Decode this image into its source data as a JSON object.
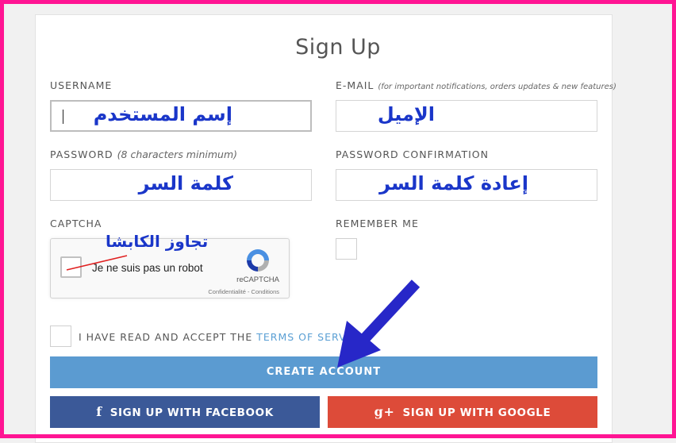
{
  "form": {
    "title": "Sign Up",
    "username_label": "USERNAME",
    "email_label": "E-MAIL",
    "email_note": "(for important notifications, orders updates & new features)",
    "password_label": "PASSWORD",
    "password_note": "(8 characters minimum)",
    "password_confirm_label": "PASSWORD CONFIRMATION",
    "captcha_label": "CAPTCHA",
    "remember_label": "REMEMBER ME",
    "terms_prefix": "I HAVE READ AND ACCEPT THE ",
    "terms_link": "TERMS OF SERV"
  },
  "annotations": {
    "username": "إسم المستخدم",
    "email": "الإميل",
    "password": "كلمة السر",
    "password_confirm": "إعادة  كلمة السر",
    "captcha": "تجاوز الكابشا"
  },
  "captcha": {
    "checkbox_text": "Je ne suis pas un robot",
    "brand": "reCAPTCHA",
    "terms": "Confidentialité - Conditions"
  },
  "buttons": {
    "create": "CREATE ACCOUNT",
    "facebook": "SIGN UP WITH FACEBOOK",
    "facebook_icon": "f",
    "google": "SIGN UP WITH GOOGLE",
    "google_icon": "g+"
  },
  "colors": {
    "frame": "#ff1493",
    "annotation": "#1a36c9",
    "create_button": "#5b9bd1",
    "facebook_button": "#3b5998",
    "google_button": "#dd4b39",
    "terms_link": "#5a9fd4"
  }
}
